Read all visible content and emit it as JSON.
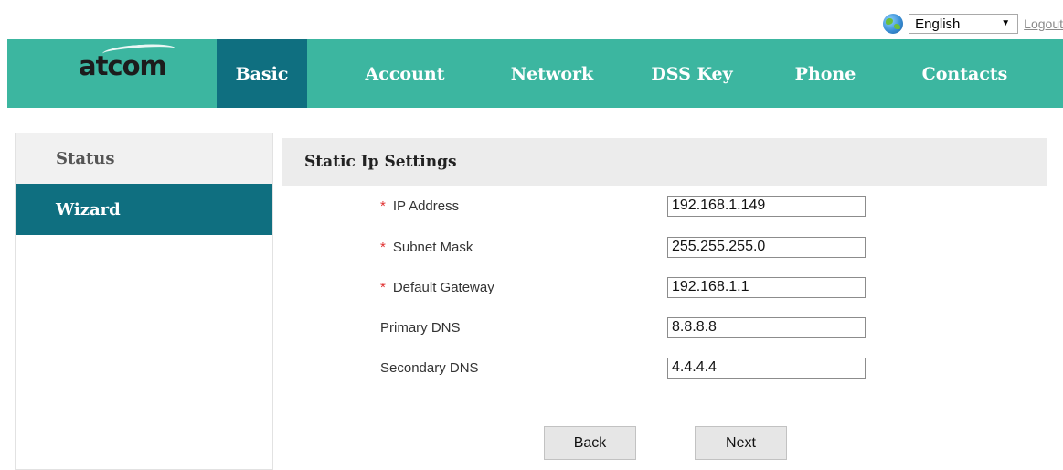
{
  "topbar": {
    "language": "English",
    "logout": "Logout"
  },
  "brand": {
    "logo_text": "atcom"
  },
  "nav": {
    "items": [
      {
        "label": "Basic",
        "active": true
      },
      {
        "label": "Account"
      },
      {
        "label": "Network"
      },
      {
        "label": "DSS Key"
      },
      {
        "label": "Phone"
      },
      {
        "label": "Contacts"
      }
    ]
  },
  "sidebar": {
    "items": [
      {
        "label": "Status"
      },
      {
        "label": "Wizard",
        "active": true
      }
    ]
  },
  "panel": {
    "title": "Static Ip Settings",
    "fields": [
      {
        "required": true,
        "label": "IP Address",
        "value": "192.168.1.149"
      },
      {
        "required": true,
        "label": "Subnet Mask",
        "value": "255.255.255.0"
      },
      {
        "required": true,
        "label": "Default Gateway",
        "value": "192.168.1.1"
      },
      {
        "required": false,
        "label": "Primary DNS",
        "value": "8.8.8.8"
      },
      {
        "required": false,
        "label": "Secondary DNS",
        "value": "4.4.4.4"
      }
    ],
    "required_marker": "*",
    "back_label": "Back",
    "next_label": "Next"
  },
  "colors": {
    "nav_bg": "#3cb6a0",
    "active_bg": "#0f6f80",
    "required": "#e03030"
  }
}
